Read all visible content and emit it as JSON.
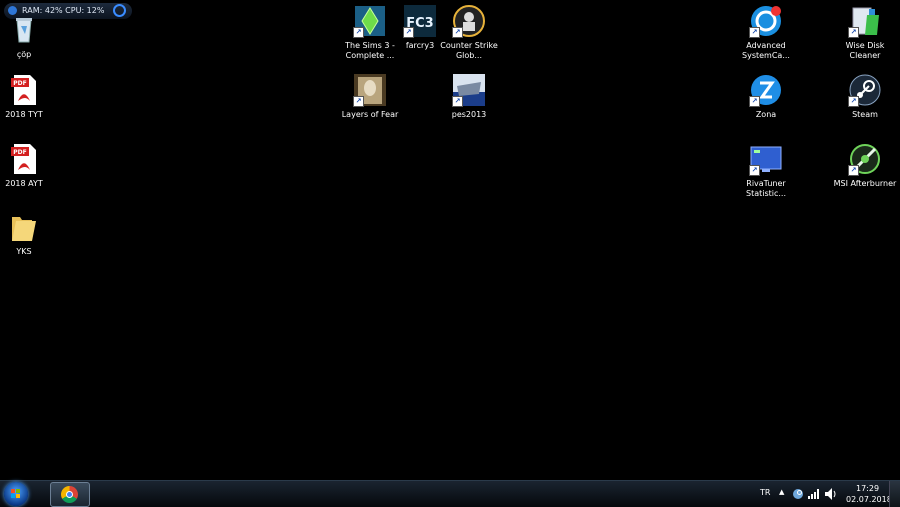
{
  "gadget": {
    "text": "RAM: 42% CPU: 12%"
  },
  "desktop": {
    "recycle": "çöp",
    "pdf1": "2018 TYT",
    "pdf2": "2018 AYT",
    "folder": "YKS",
    "sims": "The Sims 3 - Complete ...",
    "farcry": "farcry3",
    "cs": "Counter Strike Glob...",
    "layers": "Layers of Fear",
    "pes": "pes2013",
    "asc": "Advanced SystemCa...",
    "zona": "Zona",
    "riva": "RivaTuner Statistic...",
    "wise": "Wise Disk Cleaner",
    "steam": "Steam",
    "msi": "MSI Afterburner",
    "fc3_text": "FC3",
    "pdf_tag": "PDF"
  },
  "taskbar": {
    "lang": "TR",
    "time": "17:29",
    "date": "02.07.2018"
  },
  "colors": {
    "desktop_bg": "#000000",
    "taskbar_bg": "#0b1118",
    "accent": "#3a8cff"
  }
}
